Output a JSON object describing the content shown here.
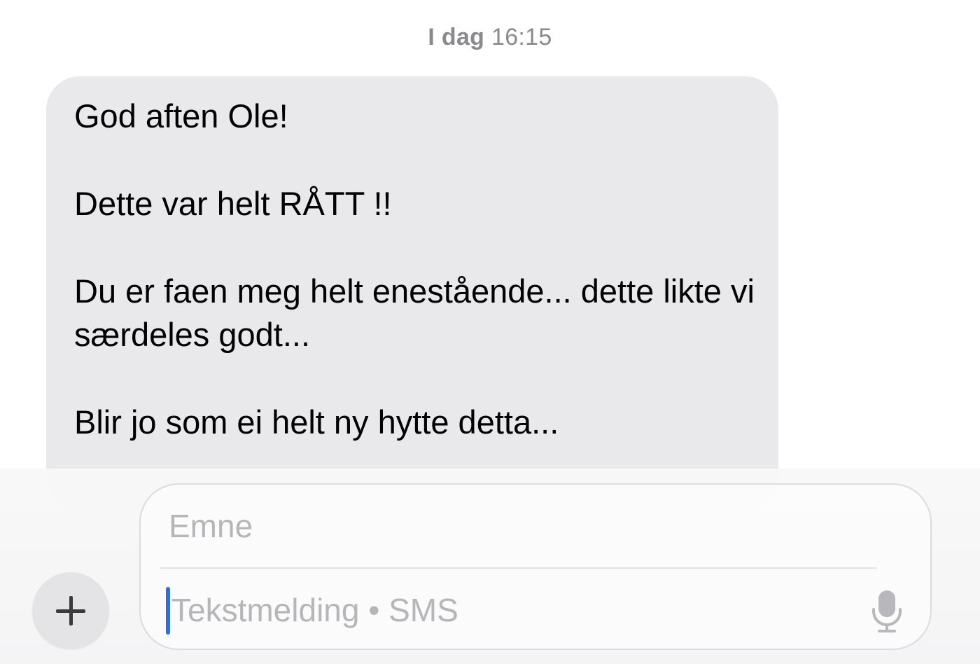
{
  "conversation": {
    "timestamp_day": "I dag",
    "timestamp_time": "16:15",
    "message": {
      "line1": "God aften Ole!",
      "line2": "Dette var helt RÅTT !!",
      "line3": "Du er faen meg helt enestående... dette likte vi særdeles godt...",
      "line4": "Blir jo som ei helt ny hytte detta..."
    }
  },
  "composer": {
    "subject_placeholder": "Emne",
    "message_placeholder": "Tekstmelding • SMS",
    "plus_icon": "plus-icon",
    "mic_icon": "microphone-icon",
    "accent_color": "#2f6bf0"
  }
}
